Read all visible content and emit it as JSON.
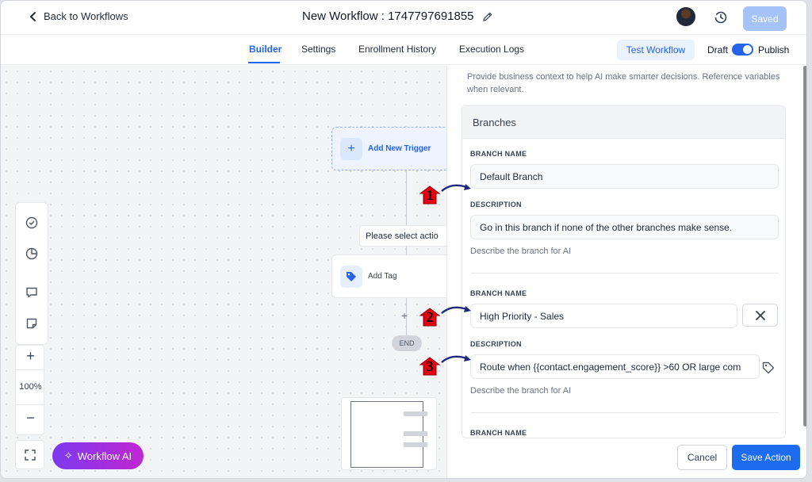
{
  "header": {
    "back_label": "Back to Workflows",
    "title": "New Workflow : 1747797691855",
    "saved_label": "Saved"
  },
  "tabs": [
    {
      "label": "Builder",
      "active": true
    },
    {
      "label": "Settings"
    },
    {
      "label": "Enrollment History"
    },
    {
      "label": "Execution Logs"
    }
  ],
  "toolbar": {
    "test_label": "Test Workflow",
    "draft_label": "Draft",
    "publish_label": "Publish",
    "publish_on": true
  },
  "canvas": {
    "trigger_label": "Add New Trigger",
    "select_action_label": "Please select actio",
    "tag_node_label": "Add Tag",
    "end_label": "END",
    "zoom_level": "100%",
    "ai_button_label": "Workflow AI"
  },
  "panel": {
    "intro": "Provide business context to help AI make smarter decisions. Reference variables when relevant.",
    "branches_title": "Branches",
    "branches": [
      {
        "name_label": "BRANCH NAME",
        "name": "Default Branch",
        "desc_label": "DESCRIPTION",
        "description": "Go in this branch if none of the other branches make sense.",
        "help": "Describe the branch for AI"
      },
      {
        "name_label": "BRANCH NAME",
        "name": "High Priority - Sales",
        "desc_label": "DESCRIPTION",
        "description": "Route when {{contact.engagement_score}} >60 OR large com",
        "help": "Describe the branch for AI"
      },
      {
        "name_label": "BRANCH NAME"
      }
    ],
    "cancel_label": "Cancel",
    "save_label": "Save Action"
  },
  "annotations": [
    "1",
    "2",
    "3"
  ],
  "colors": {
    "accent": "#2563eb",
    "marker": "#e60012",
    "ai_gradient_start": "#7c3aed",
    "ai_gradient_end": "#c026d3"
  }
}
